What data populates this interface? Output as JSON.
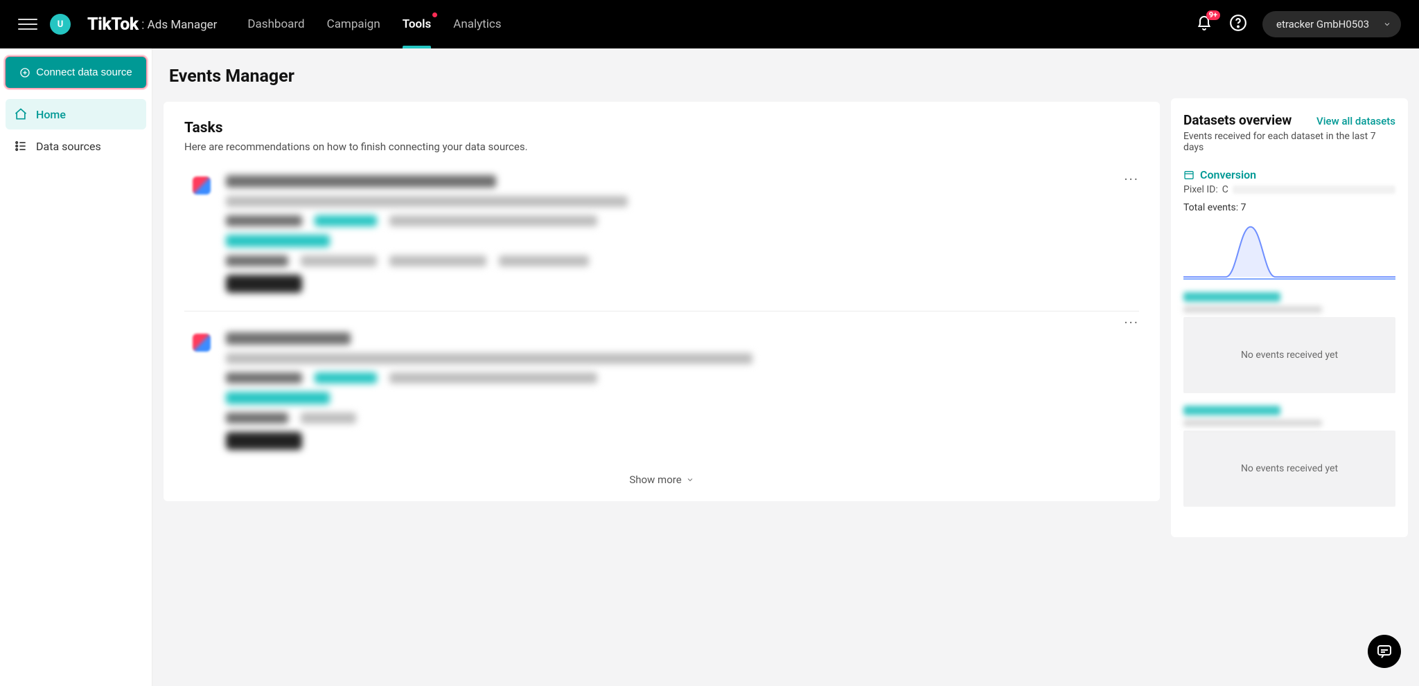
{
  "topbar": {
    "avatar_initial": "U",
    "brand_main": "TikTok",
    "brand_sub": "Ads Manager",
    "nav": [
      {
        "label": "Dashboard",
        "active": false
      },
      {
        "label": "Campaign",
        "active": false
      },
      {
        "label": "Tools",
        "active": true,
        "dot": true
      },
      {
        "label": "Analytics",
        "active": false
      }
    ],
    "notifications_badge": "9+",
    "account_label": "etracker GmbH0503"
  },
  "sidebar": {
    "connect_label": "Connect data source",
    "items": [
      {
        "label": "Home",
        "active": true
      },
      {
        "label": "Data sources",
        "active": false
      }
    ]
  },
  "page": {
    "title": "Events Manager"
  },
  "tasks": {
    "title": "Tasks",
    "subtitle": "Here are recommendations on how to finish connecting your data sources.",
    "show_more": "Show more"
  },
  "overview": {
    "title": "Datasets overview",
    "view_all": "View all datasets",
    "subtitle": "Events received for each dataset in the last 7 days",
    "datasets": [
      {
        "name": "Conversion",
        "pixel_label": "Pixel ID:",
        "pixel_prefix": "C",
        "total_events_label": "Total events:",
        "total_events_value": "7"
      }
    ],
    "no_events": "No events received yet"
  }
}
